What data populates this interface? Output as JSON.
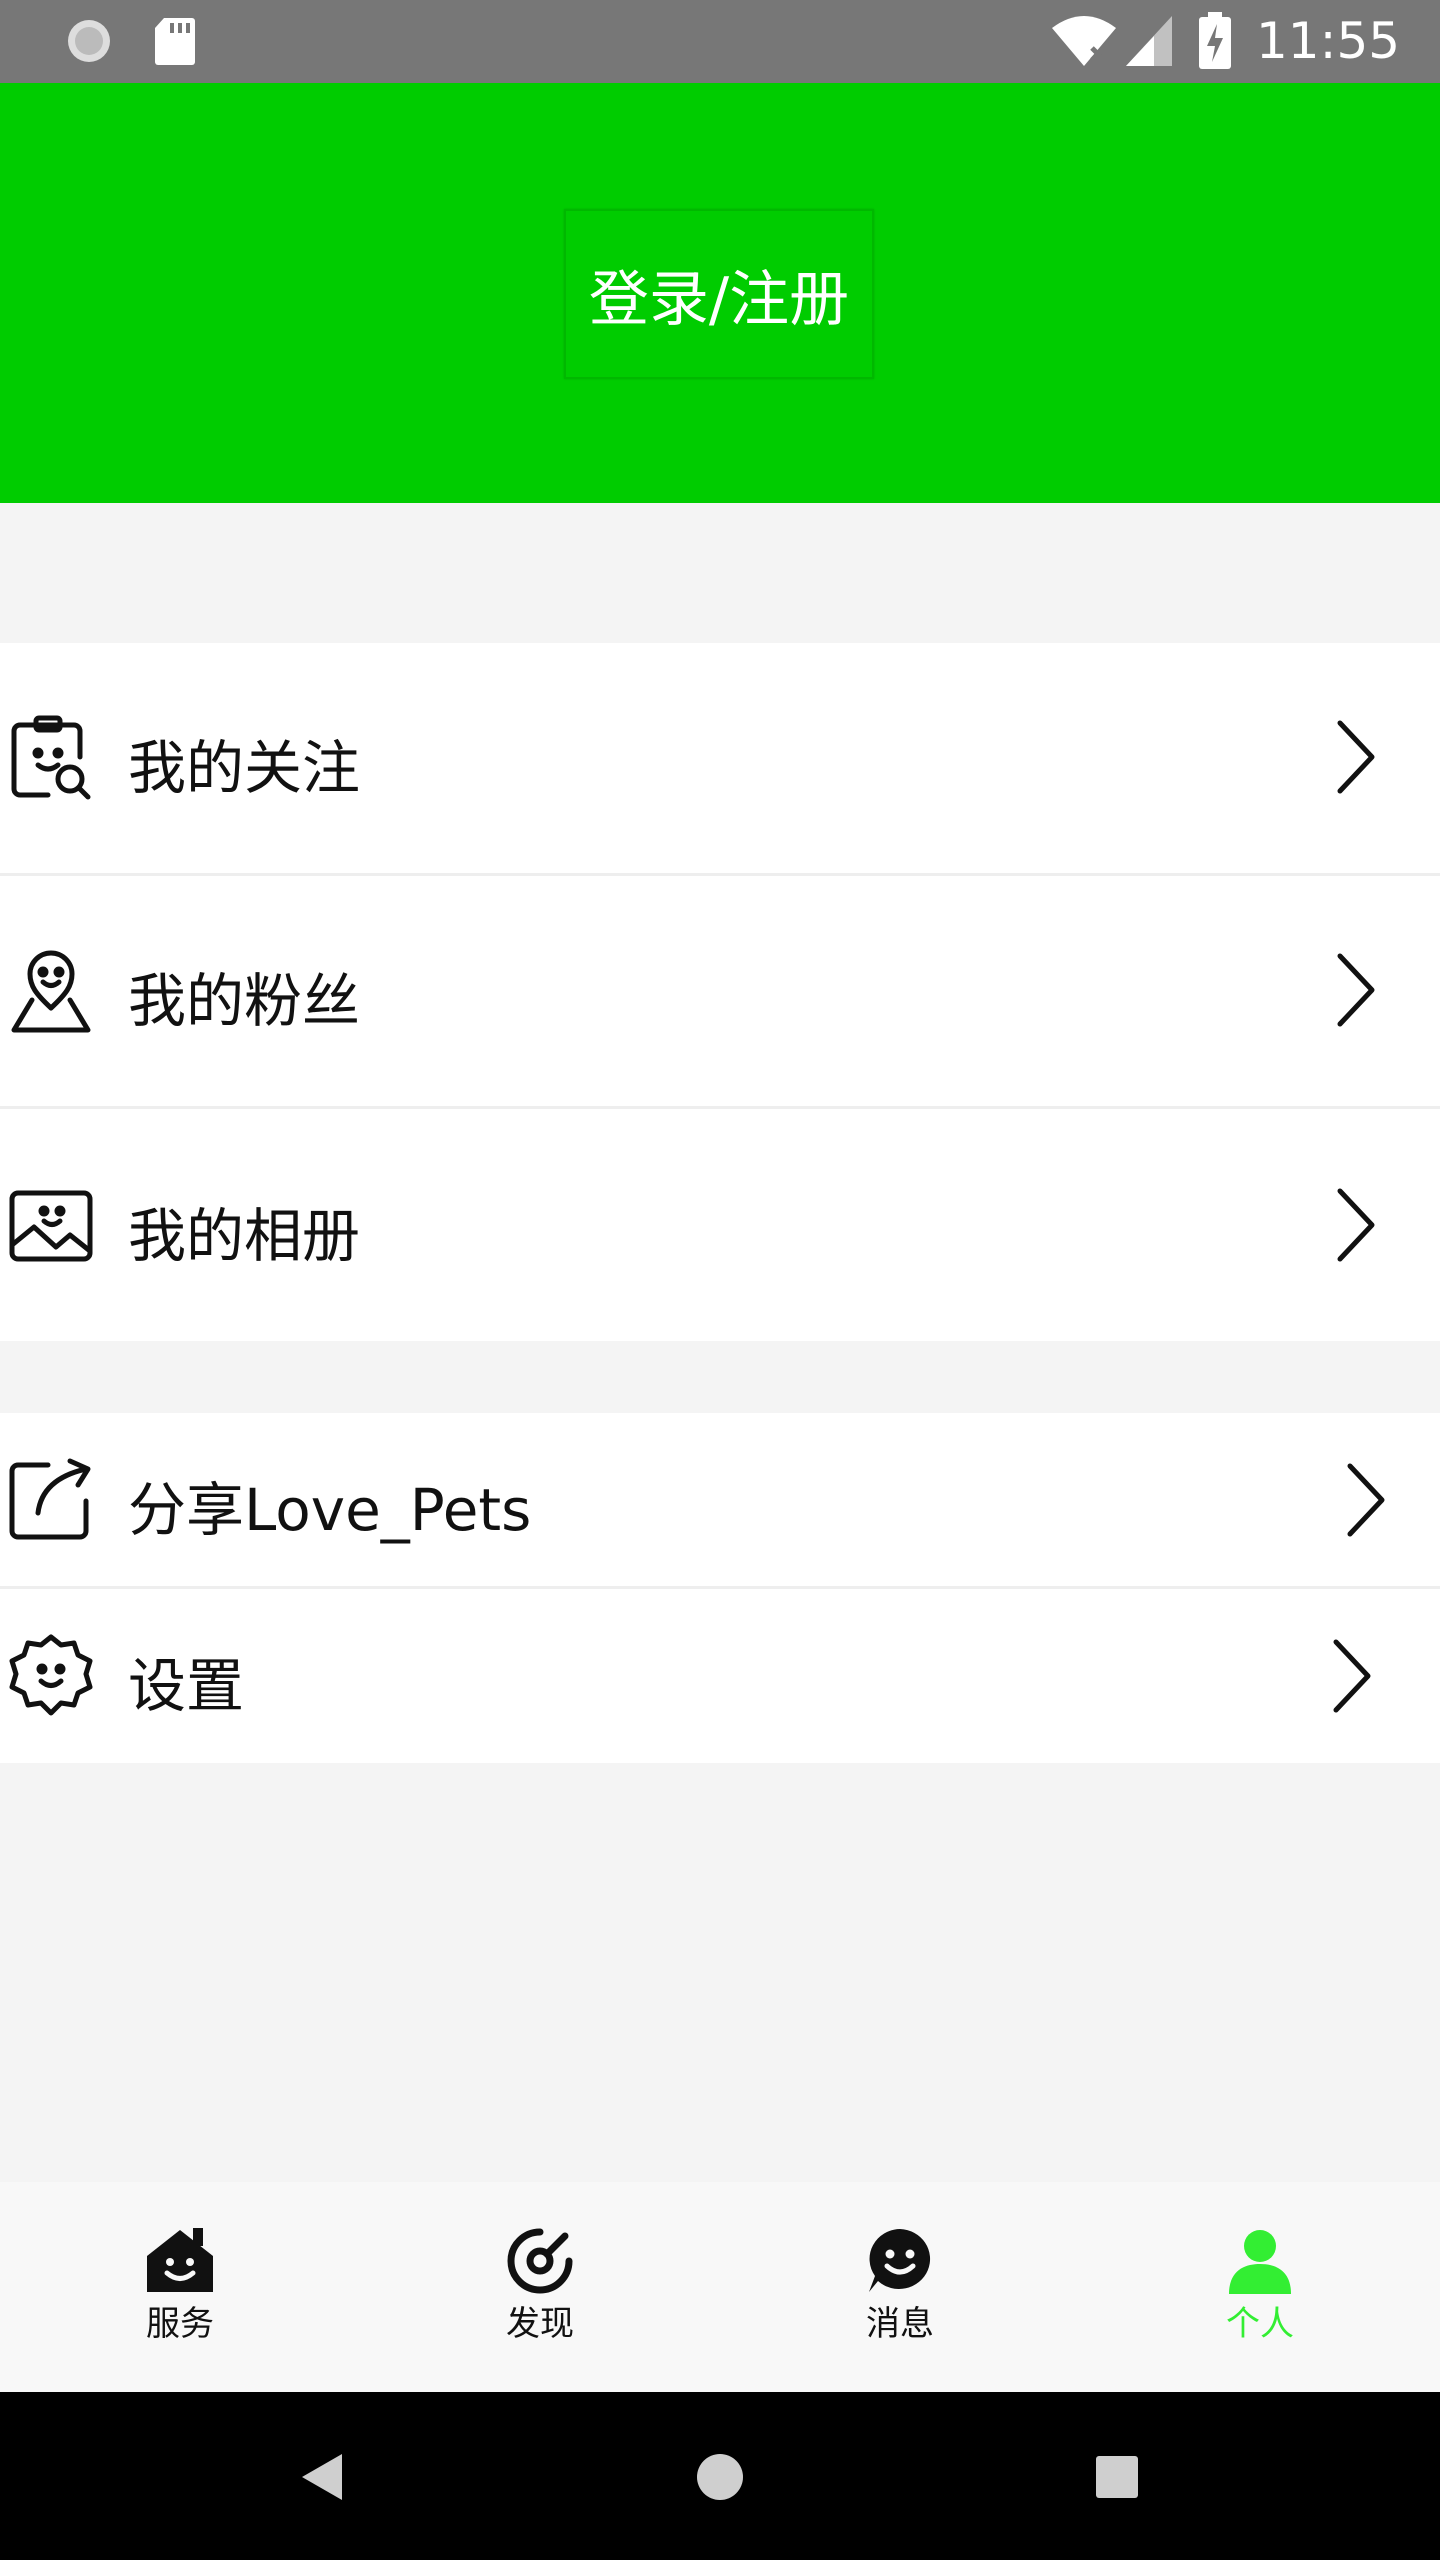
{
  "status_bar": {
    "time": "11:55",
    "icons": [
      "loading-icon",
      "sd-card-icon",
      "wifi-icon",
      "signal-icon",
      "battery-charging-icon"
    ]
  },
  "header": {
    "login_label": "登录/注册",
    "background_color": "#00cc00"
  },
  "menu_group_1": [
    {
      "label": "我的关注",
      "icon": "clipboard-search-icon"
    },
    {
      "label": "我的粉丝",
      "icon": "smile-person-icon"
    },
    {
      "label": "我的相册",
      "icon": "smile-picture-icon"
    }
  ],
  "menu_group_2": [
    {
      "label": "分享Love_Pets",
      "icon": "share-icon"
    },
    {
      "label": "设置",
      "icon": "settings-smile-icon"
    }
  ],
  "tab_bar": {
    "items": [
      {
        "label": "服务",
        "icon": "home-smile-icon",
        "active": false
      },
      {
        "label": "发现",
        "icon": "compass-icon",
        "active": false
      },
      {
        "label": "消息",
        "icon": "message-smile-icon",
        "active": false
      },
      {
        "label": "个人",
        "icon": "person-icon",
        "active": true
      }
    ],
    "active_color": "#33ee33"
  },
  "nav_bar": {
    "buttons": [
      "back-icon",
      "home-icon",
      "recents-icon"
    ]
  }
}
